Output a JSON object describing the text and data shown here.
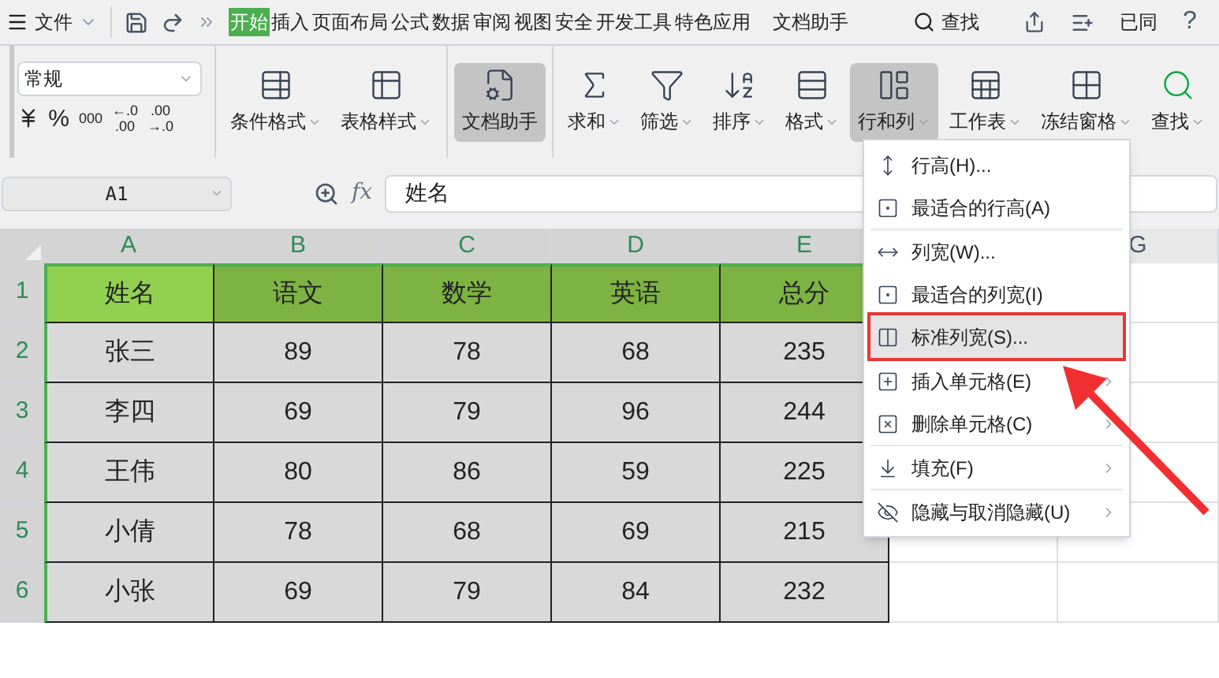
{
  "menu_bar": {
    "file": "文件",
    "tabs": [
      {
        "label": "开始",
        "selected": true
      },
      {
        "label": "插入",
        "selected": false
      },
      {
        "label": "页面布局",
        "selected": false
      },
      {
        "label": "公式",
        "selected": false
      },
      {
        "label": "数据",
        "selected": false
      },
      {
        "label": "审阅",
        "selected": false
      },
      {
        "label": "视图",
        "selected": false
      },
      {
        "label": "安全",
        "selected": false
      },
      {
        "label": "开发工具",
        "selected": false
      },
      {
        "label": "特色应用",
        "selected": false
      },
      {
        "label": "文档助手",
        "selected": false
      }
    ],
    "search": "查找",
    "sync": "已同",
    "help": "?"
  },
  "ribbon": {
    "number_format": "常规",
    "number_buttons": [
      "%",
      "000",
      "←.0\n.00",
      ".00\n→.0"
    ],
    "groups": [
      [
        {
          "label": "条件格式",
          "dropdown": true,
          "active": false
        },
        {
          "label": "表格样式",
          "dropdown": true,
          "active": false
        }
      ],
      [
        {
          "label": "文档助手",
          "dropdown": false,
          "active": true
        }
      ],
      [
        {
          "label": "求和",
          "dropdown": true,
          "active": false
        },
        {
          "label": "筛选",
          "dropdown": true,
          "active": false
        },
        {
          "label": "排序",
          "dropdown": true,
          "active": false
        },
        {
          "label": "格式",
          "dropdown": true,
          "active": false
        },
        {
          "label": "行和列",
          "dropdown": true,
          "active": true
        },
        {
          "label": "工作表",
          "dropdown": true,
          "active": false
        },
        {
          "label": "冻结窗格",
          "dropdown": true,
          "active": false
        },
        {
          "label": "查找",
          "dropdown": true,
          "active": false
        }
      ]
    ]
  },
  "formula_bar": {
    "name_box": "A1",
    "fx": "fx",
    "value": "姓名"
  },
  "sheet": {
    "columns": [
      {
        "label": "A",
        "selected": true
      },
      {
        "label": "B",
        "selected": true
      },
      {
        "label": "C",
        "selected": true
      },
      {
        "label": "D",
        "selected": true
      },
      {
        "label": "E",
        "selected": true
      },
      {
        "label": "G",
        "selected": false
      }
    ],
    "rows": [
      {
        "label": "1",
        "cells": [
          "姓名",
          "语文",
          "数学",
          "英语",
          "总分"
        ]
      },
      {
        "label": "2",
        "cells": [
          "张三",
          "89",
          "78",
          "68",
          "235"
        ]
      },
      {
        "label": "3",
        "cells": [
          "李四",
          "69",
          "79",
          "96",
          "244"
        ]
      },
      {
        "label": "4",
        "cells": [
          "王伟",
          "80",
          "86",
          "59",
          "225"
        ]
      },
      {
        "label": "5",
        "cells": [
          "小倩",
          "78",
          "68",
          "69",
          "215"
        ]
      },
      {
        "label": "6",
        "cells": [
          "小张",
          "69",
          "79",
          "84",
          "232"
        ]
      }
    ]
  },
  "context_menu": {
    "groups": [
      [
        {
          "label": "行高(H)...",
          "selected": false,
          "submenu": false
        },
        {
          "label": "最适合的行高(A)",
          "selected": false,
          "submenu": false
        }
      ],
      [
        {
          "label": "列宽(W)...",
          "selected": false,
          "submenu": false
        },
        {
          "label": "最适合的列宽(I)",
          "selected": false,
          "submenu": false
        },
        {
          "label": "标准列宽(S)...",
          "selected": true,
          "submenu": false
        }
      ],
      [
        {
          "label": "插入单元格(E)",
          "selected": false,
          "submenu": true
        },
        {
          "label": "删除单元格(C)",
          "selected": false,
          "submenu": true
        }
      ],
      [
        {
          "label": "填充(F)",
          "selected": false,
          "submenu": true
        }
      ],
      [
        {
          "label": "隐藏与取消隐藏(U)",
          "selected": false,
          "submenu": true
        }
      ]
    ]
  }
}
